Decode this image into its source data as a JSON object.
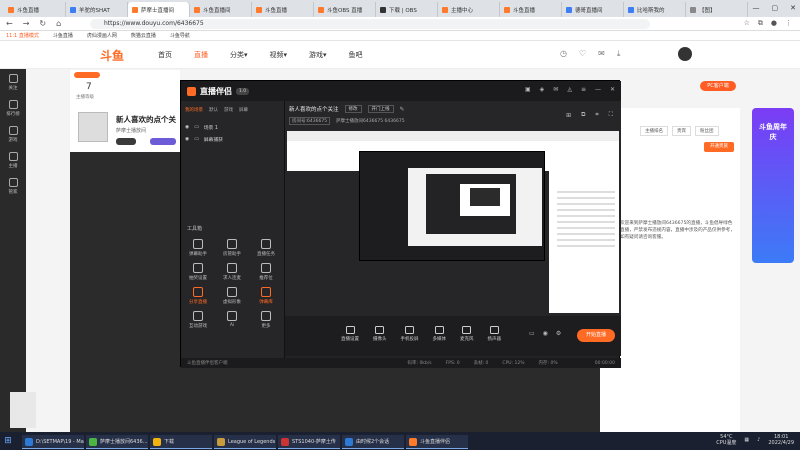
{
  "browser": {
    "tabs": [
      {
        "label": "斗鱼直播",
        "color": "#ff7a2a"
      },
      {
        "label": "羊驼的SHAT",
        "color": "#3d7df6"
      },
      {
        "label": "萨摩士直播间",
        "color": "#ff7a2a"
      },
      {
        "label": "斗鱼直播间",
        "color": "#ff7a2a"
      },
      {
        "label": "斗鱼直播",
        "color": "#ff7a2a"
      },
      {
        "label": "斗鱼OBS 直播",
        "color": "#ff7a2a"
      },
      {
        "label": "下载 | OBS",
        "color": "#333333"
      },
      {
        "label": "主播中心",
        "color": "#ff7a2a"
      },
      {
        "label": "斗鱼直播",
        "color": "#ff7a2a"
      },
      {
        "label": "德哥直播间",
        "color": "#3d7df6"
      },
      {
        "label": "比哈斯我的",
        "color": "#3d7df6"
      },
      {
        "label": "【图】",
        "color": "#888888"
      }
    ],
    "url": "https://www.douyu.com/6436675",
    "bookmarks": [
      "斗鱼直播",
      "虎仙漫画人网",
      "熊猫云直播",
      "斗鱼导航"
    ],
    "mode_label": "11:1 直播模式"
  },
  "site": {
    "logo": "斗鱼",
    "nav": [
      {
        "label": "首页",
        "active": false
      },
      {
        "label": "直播",
        "active": true
      },
      {
        "label": "分类▾",
        "active": false
      },
      {
        "label": "视频▾",
        "active": false
      },
      {
        "label": "游戏▾",
        "active": false
      },
      {
        "label": "鱼吧",
        "active": false
      }
    ],
    "left_sidebar": [
      "关注",
      "排行榜",
      "游戏",
      "主播",
      "管家"
    ],
    "streamer_name": "新人喜欢的点个关",
    "streamer_sub": "萨摩士播放间",
    "streamer_level": "7",
    "streamer_level_label": "主播等级",
    "pc_button": "PC客户端",
    "right_panel_text": "欢迎来到萨摩士播放间6436675的直播，斗鱼倡导绿色直播，严禁发布违规内容，直播中涉及的产品仅供参考，如有疑问请咨询客服。",
    "right_panel_tabs": [
      "主播排名",
      "贵宾",
      "粉丝团"
    ],
    "follow_button": "开通贵族",
    "ad_text": "斗鱼周年庆"
  },
  "app": {
    "title": "直播伴侣",
    "version": "1.0",
    "scene_tabs": [
      "我的场景",
      "默认",
      "游戏",
      "屏幕"
    ],
    "sources": [
      {
        "label": "场景 1",
        "visible": true
      },
      {
        "label": "屏幕捕获",
        "visible": true
      }
    ],
    "stream_title": "新人喜欢的点个关注",
    "category_btn": "修改",
    "upload_btn": "开门上线",
    "room_id": "房间号:6436675",
    "room_info": "萨摩士播放间6436675  6436675",
    "tools_title": "工具箱",
    "tools": [
      {
        "label": "弹幕助手",
        "accent": false
      },
      {
        "label": "房管助手",
        "accent": false
      },
      {
        "label": "直播任务",
        "accent": false
      },
      {
        "label": "抽奖设置",
        "accent": false
      },
      {
        "label": "求人连麦",
        "accent": false
      },
      {
        "label": "推荐位",
        "accent": false
      },
      {
        "label": "分享直播",
        "accent": true
      },
      {
        "label": "虚拟形象",
        "accent": false
      },
      {
        "label": "弹幕库",
        "accent": true
      },
      {
        "label": "互动游戏",
        "accent": false
      },
      {
        "label": "Ai",
        "accent": false
      },
      {
        "label": "更多",
        "accent": false
      }
    ],
    "controls": [
      "直播设置",
      "摄像头",
      "手机投屏",
      "多媒体",
      "麦克风",
      "扬声器"
    ],
    "go_live": "开始直播",
    "status_left": "斗鱼直播伴侣客户端",
    "status_items": [
      "码率: 0kb/s",
      "FPS: 0",
      "丢帧: 0",
      "CPU: 12%",
      "内存: 0%"
    ],
    "timer": "00:00:00"
  },
  "taskbar": {
    "start": "开始",
    "tasks": [
      {
        "label": "D:\\SETMAP\\19 - Ma...",
        "color": "#2d7ad6"
      },
      {
        "label": "萨摩士播放间6436...",
        "color": "#4bb543"
      },
      {
        "label": "下载",
        "color": "#f2b20f"
      },
      {
        "label": "League of Legends",
        "color": "#c89b3c"
      },
      {
        "label": "STS1040-萨摩土传",
        "color": "#c33"
      },
      {
        "label": "由时候2个会话",
        "color": "#2d7ad6"
      },
      {
        "label": "斗鱼直播伴侣",
        "color": "#ff7a2a"
      }
    ],
    "weather": "54°C",
    "weather_sub": "CPU温度",
    "time": "18:01",
    "date": "2022/4/29"
  }
}
